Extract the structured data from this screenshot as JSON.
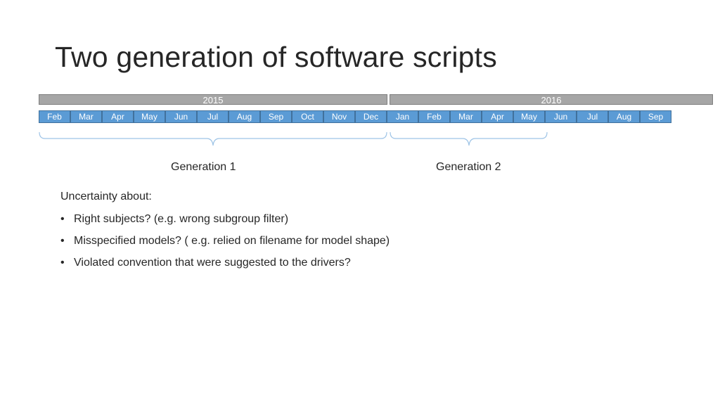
{
  "title": "Two generation of software scripts",
  "years": [
    {
      "label": "2015"
    },
    {
      "label": "2016"
    }
  ],
  "months": [
    "Feb",
    "Mar",
    "Apr",
    "May",
    "Jun",
    "Jul",
    "Aug",
    "Sep",
    "Oct",
    "Nov",
    "Dec",
    "Jan",
    "Feb",
    "Mar",
    "Apr",
    "May",
    "Jun",
    "Jul",
    "Aug",
    "Sep"
  ],
  "generations": [
    {
      "label": "Generation 1"
    },
    {
      "label": "Generation 2"
    }
  ],
  "notes": {
    "heading": "Uncertainty about:",
    "bullet_glyph": "•",
    "items": [
      "Right subjects? (e.g. wrong subgroup filter)",
      "Misspecified models? ( e.g. relied on filename for model shape)",
      "Violated convention that were suggested to the drivers?"
    ]
  },
  "colors": {
    "month_fill": "#5b9bd5",
    "month_border": "#41719c",
    "year_fill": "#a6a6a6",
    "brace": "#9dc3e6",
    "text": "#262626"
  }
}
